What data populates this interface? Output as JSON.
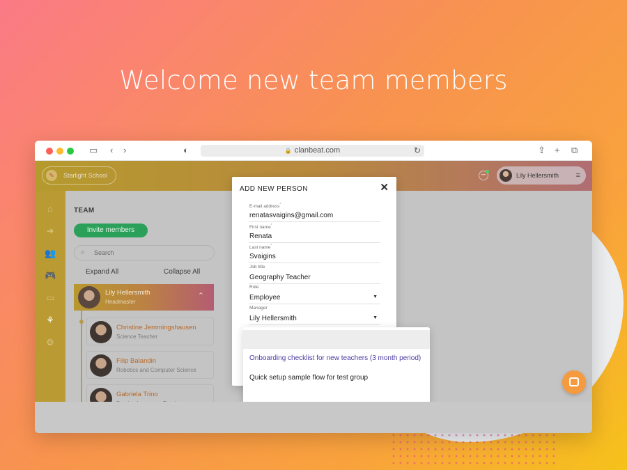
{
  "headline": "Welcome new team members",
  "browser": {
    "url": "clanbeat.com"
  },
  "topbar": {
    "school_name": "Starlight School",
    "user_name": "Lily Hellersmith"
  },
  "team": {
    "title": "TEAM",
    "invite_label": "Invite members",
    "search_placeholder": "Search",
    "expand_all": "Expand All",
    "collapse_all": "Collapse All",
    "lead": {
      "name": "Lily Hellersmith",
      "role": "Headmaster"
    },
    "members": [
      {
        "name": "Christine Jemmingshausen",
        "role": "Science Teacher"
      },
      {
        "name": "Filip Balandin",
        "role": "Robotics and Computer Science"
      },
      {
        "name": "Gabriela Trino",
        "role": "Foreign Language Teacher"
      }
    ]
  },
  "modal": {
    "title": "ADD NEW PERSON",
    "fields": [
      {
        "label": "E-mail address",
        "required": true,
        "value": "renatasvaigins@gmail.com"
      },
      {
        "label": "First name",
        "required": true,
        "value": "Renata"
      },
      {
        "label": "Last name",
        "required": true,
        "value": "Svaigins"
      },
      {
        "label": "Job title",
        "required": false,
        "value": "Geography Teacher"
      },
      {
        "label": "Role",
        "required": false,
        "value": "Employee"
      },
      {
        "label": "Manager",
        "required": false,
        "value": "Lily Hellersmith"
      }
    ]
  },
  "dropdown": {
    "options": [
      "Onboarding checklist for new teachers (3 month period)",
      "Quick setup sample flow for test group"
    ]
  },
  "colors": {
    "accent_green": "#2aa05a",
    "link_purple": "#4a3ca0",
    "chat_orange": "#f59a3e"
  }
}
